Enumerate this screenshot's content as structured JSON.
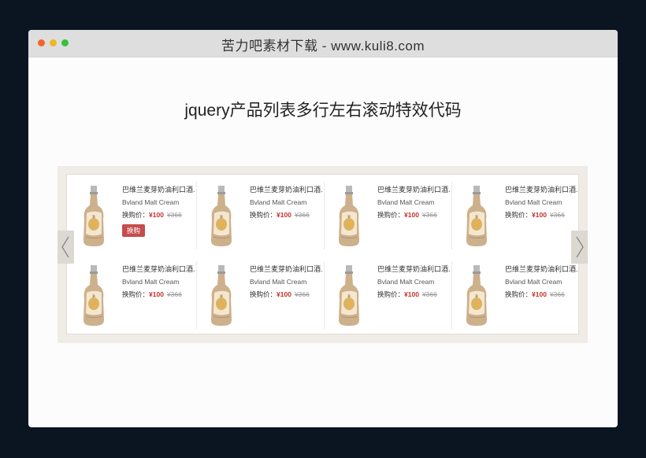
{
  "window": {
    "title": "苦力吧素材下载 - www.kuli8.com"
  },
  "page": {
    "heading": "jquery产品列表多行左右滚动特效代码"
  },
  "colors": {
    "dot_red": "#f2662a",
    "dot_yellow": "#f0b623",
    "dot_green": "#35c23b",
    "price_red": "#c6302c",
    "buy_button": "#c44d4d"
  },
  "slider": {
    "prev_icon": "chevron-left-icon",
    "next_icon": "chevron-right-icon",
    "products": [
      {
        "name": "巴维兰麦芽奶油利口酒...",
        "name_en": "Bvland Malt Cream",
        "price_label": "换购价：",
        "price": "¥100",
        "old_price": "¥366",
        "buy_label": "换购"
      },
      {
        "name": "巴维兰麦芽奶油利口酒...",
        "name_en": "Bvland Malt Cream",
        "price_label": "换购价：",
        "price": "¥100",
        "old_price": "¥366"
      },
      {
        "name": "巴维兰麦芽奶油利口酒...",
        "name_en": "Bvland Malt Cream",
        "price_label": "换购价：",
        "price": "¥100",
        "old_price": "¥366"
      },
      {
        "name": "巴维兰麦芽奶油利口酒...",
        "name_en": "Bvland Malt Cream",
        "price_label": "换购价：",
        "price": "¥100",
        "old_price": "¥366"
      },
      {
        "name": "巴维兰麦芽奶油利口酒...",
        "name_en": "Bvland Malt Cream",
        "price_label": "换购价：",
        "price": "¥100",
        "old_price": "¥366"
      },
      {
        "name": "巴维兰麦芽奶油利口酒...",
        "name_en": "Bvland Malt Cream",
        "price_label": "换购价：",
        "price": "¥100",
        "old_price": "¥366"
      },
      {
        "name": "巴维兰麦芽奶油利口酒...",
        "name_en": "Bvland Malt Cream",
        "price_label": "换购价：",
        "price": "¥100",
        "old_price": "¥366"
      },
      {
        "name": "巴维兰麦芽奶油利口酒...",
        "name_en": "Bvland Malt Cream",
        "price_label": "换购价：",
        "price": "¥100",
        "old_price": "¥366"
      }
    ]
  }
}
